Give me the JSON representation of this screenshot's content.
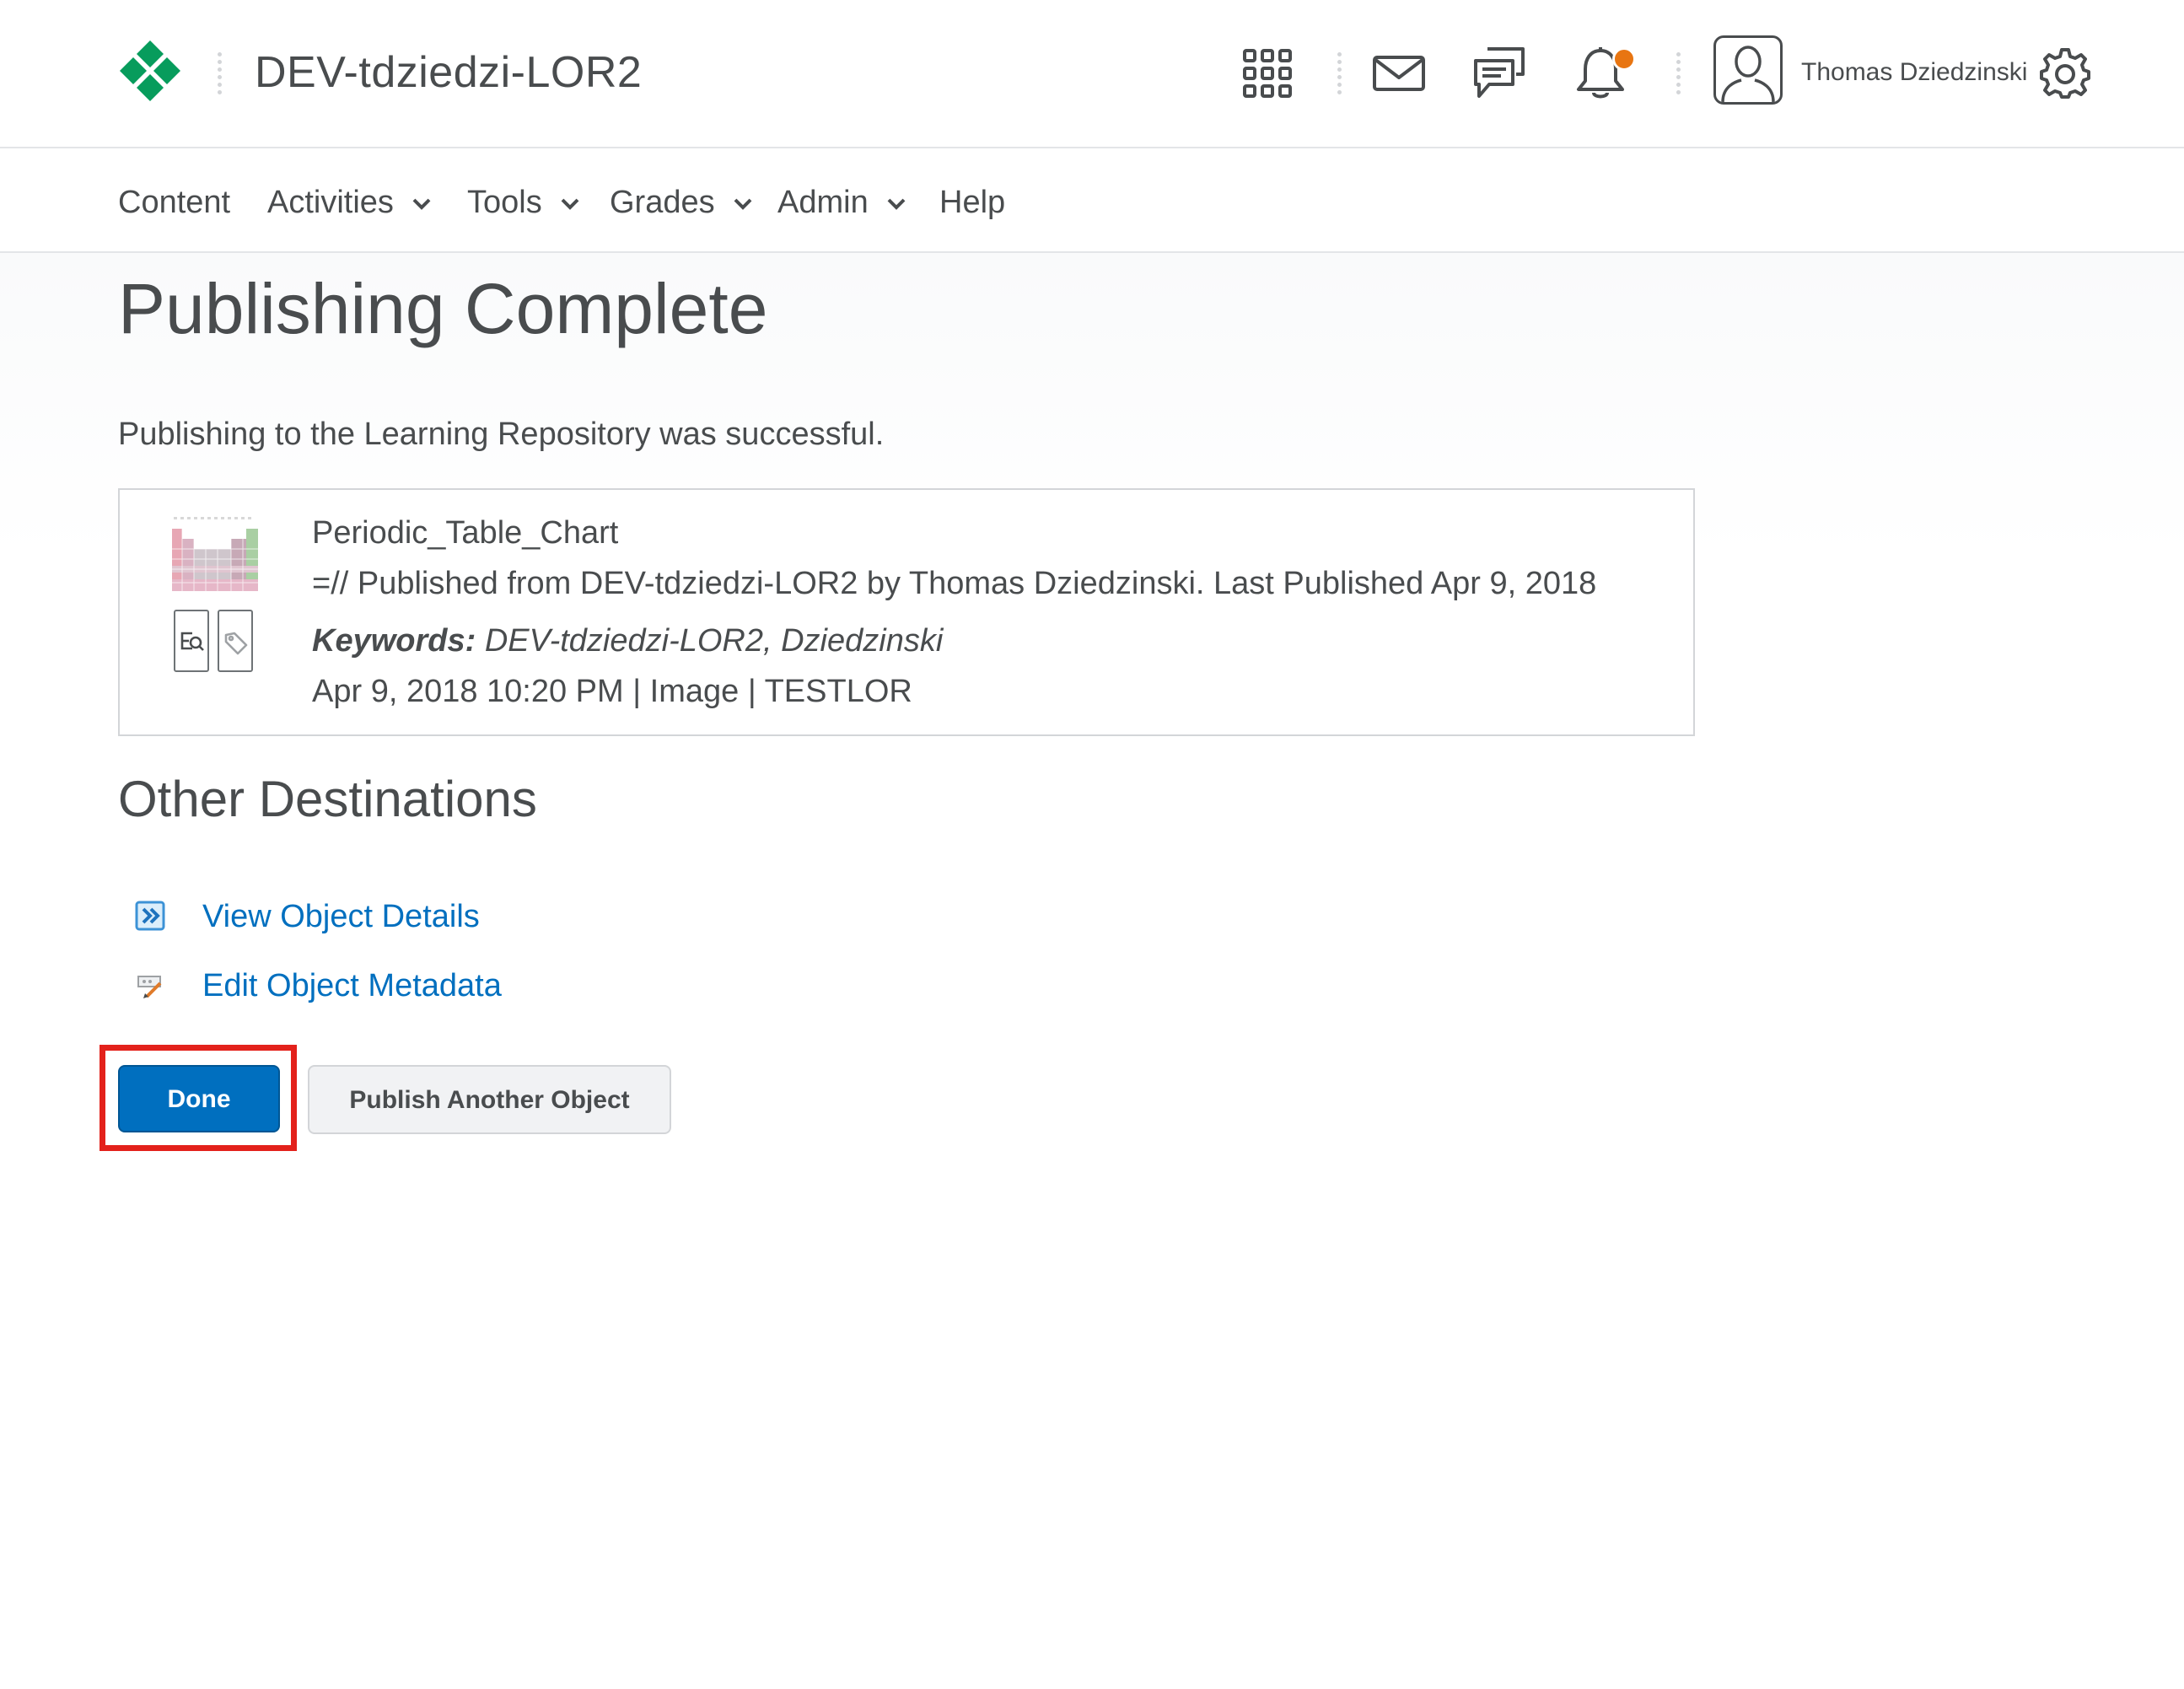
{
  "header": {
    "org_title": "DEV-tdziedzi-LOR2",
    "user_name": "Thomas Dziedzinski",
    "icons": [
      "waffle-icon",
      "message-icon",
      "chat-icon",
      "bell-icon",
      "gear-icon"
    ],
    "logo_color": "#079c5c",
    "notification_color": "#e87511"
  },
  "nav": {
    "items": [
      {
        "label": "Content"
      },
      {
        "label": "Activities"
      },
      {
        "label": "Tools"
      },
      {
        "label": "Grades"
      },
      {
        "label": "Admin"
      },
      {
        "label": "Help"
      }
    ]
  },
  "page": {
    "title": "Publishing Complete",
    "success_message": "Publishing to the Learning Repository was successful."
  },
  "object": {
    "name": "Periodic_Table_Chart",
    "description": "=// Published from DEV-tdziedzi-LOR2 by Thomas Dziedzinski. Last Published Apr 9, 2018",
    "keywords_label": "Keywords:",
    "keywords": "DEV-tdziedzi-LOR2, Dziedzinski",
    "meta": "Apr 9, 2018 10:20 PM | Image | TESTLOR"
  },
  "destinations": {
    "title": "Other Destinations",
    "links": [
      {
        "label": "View Object Details",
        "icon": "view-details-icon"
      },
      {
        "label": "Edit Object Metadata",
        "icon": "edit-metadata-icon"
      }
    ]
  },
  "actions": {
    "done_label": "Done",
    "publish_another_label": "Publish Another Object",
    "primary_color": "#006fbf",
    "highlight_color": "#e3211b"
  }
}
